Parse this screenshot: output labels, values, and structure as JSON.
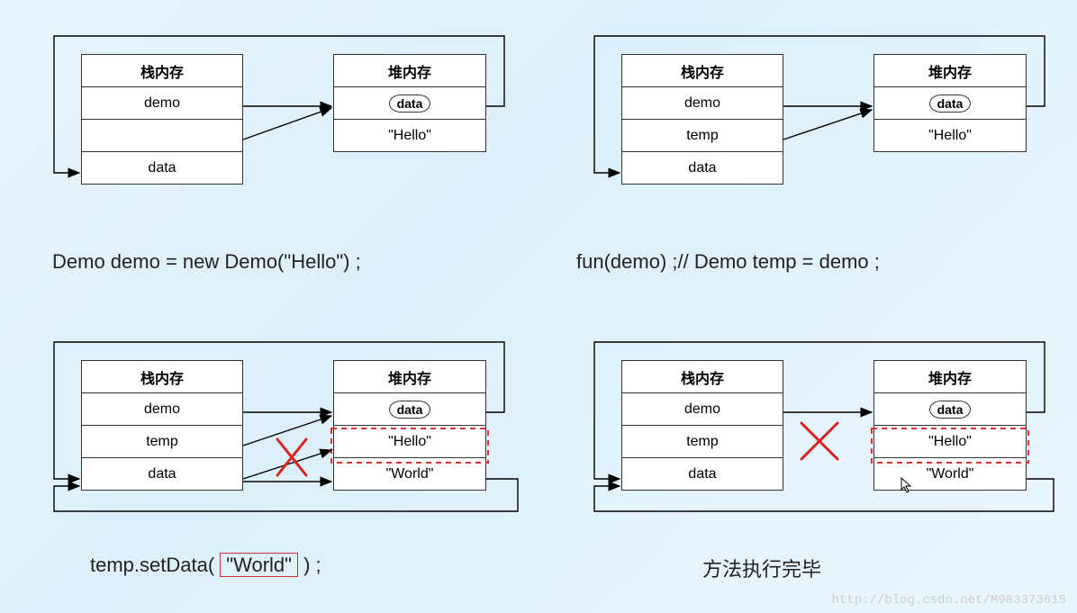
{
  "labels": {
    "stack_header": "栈内存",
    "heap_header": "堆内存",
    "data_badge": "data",
    "hello": "\"Hello\"",
    "world": "\"World\""
  },
  "panels": {
    "tl": {
      "stack": [
        "demo",
        "",
        "data"
      ],
      "heap": [
        "data",
        "\"Hello\""
      ],
      "caption": "Demo demo = new Demo(\"Hello\") ;"
    },
    "tr": {
      "stack": [
        "demo",
        "temp",
        "data"
      ],
      "heap": [
        "data",
        "\"Hello\""
      ],
      "caption": "fun(demo) ;// Demo temp = demo ;"
    },
    "bl": {
      "stack": [
        "demo",
        "temp",
        "data"
      ],
      "heap": [
        "data",
        "\"Hello\"",
        "\"World\""
      ],
      "caption_prefix": "temp.setData(  ",
      "caption_highlight": "\"World\"",
      "caption_suffix": "  ) ;"
    },
    "br": {
      "stack": [
        "demo",
        "temp",
        "data"
      ],
      "heap": [
        "data",
        "\"Hello\"",
        "\"World\""
      ],
      "caption": "方法执行完毕"
    }
  },
  "watermark": "http://blog.csdn.net/M983373615"
}
